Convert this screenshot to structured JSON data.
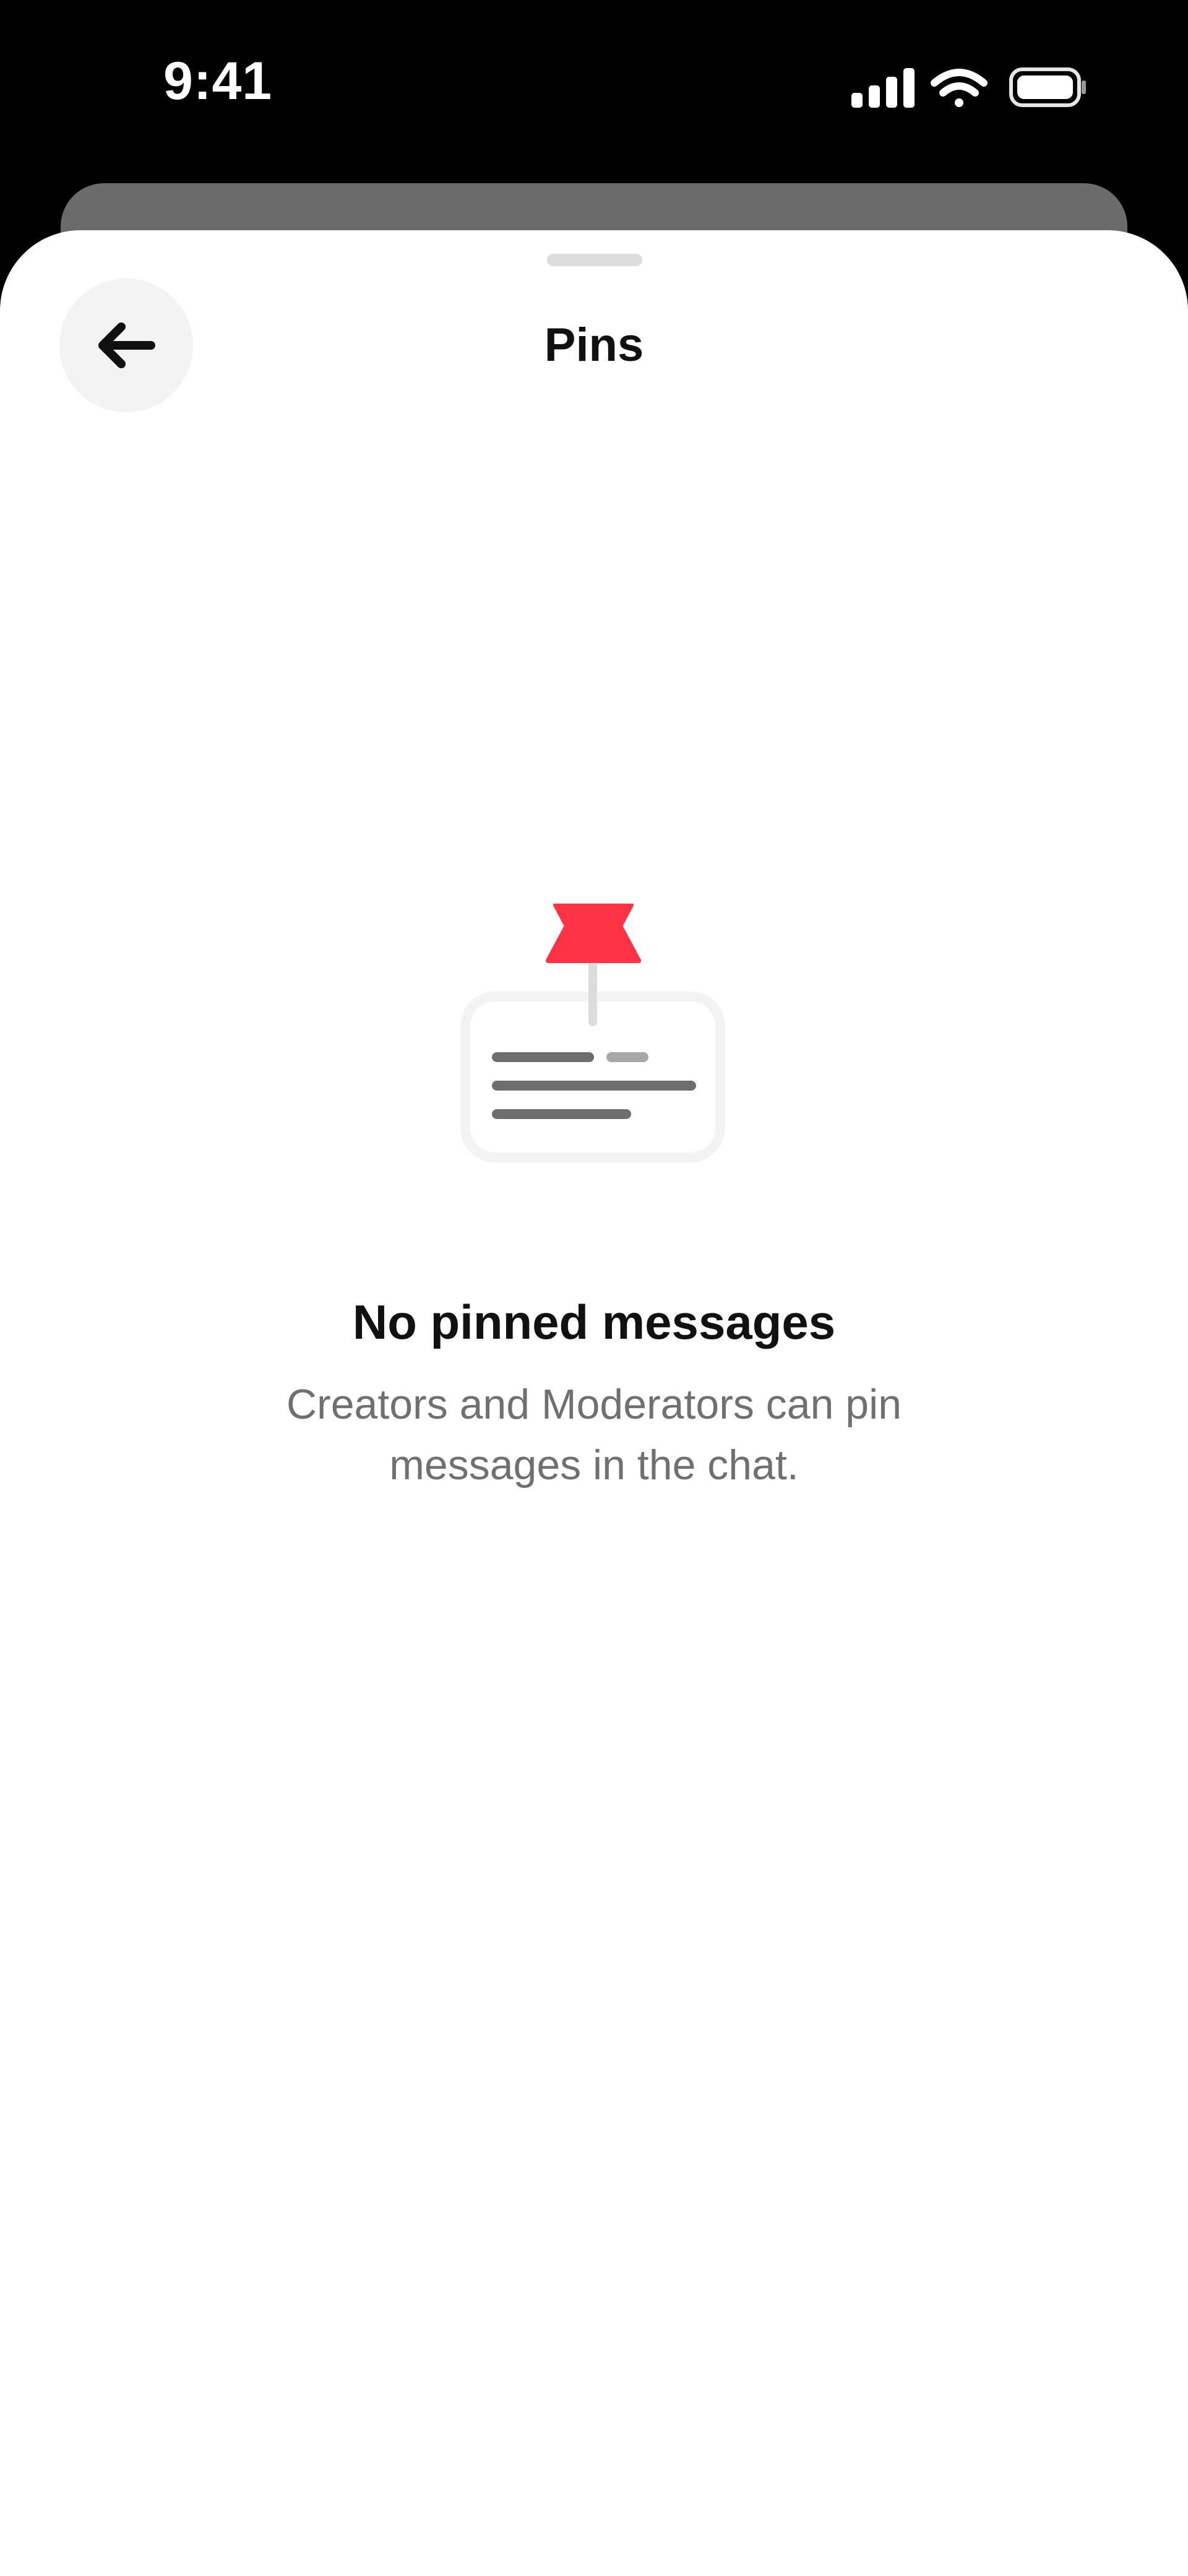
{
  "status_bar": {
    "time": "9:41",
    "signal_icon": "cellular-signal-icon",
    "wifi_icon": "wifi-icon",
    "battery_icon": "battery-icon"
  },
  "sheet": {
    "title": "Pins",
    "back_icon": "arrow-left-icon"
  },
  "empty_state": {
    "illustration": "pinned-message-illustration",
    "pin_color": "#ff3344",
    "title": "No pinned messages",
    "subtitle": "Creators and Moderators can pin messages in the chat."
  }
}
